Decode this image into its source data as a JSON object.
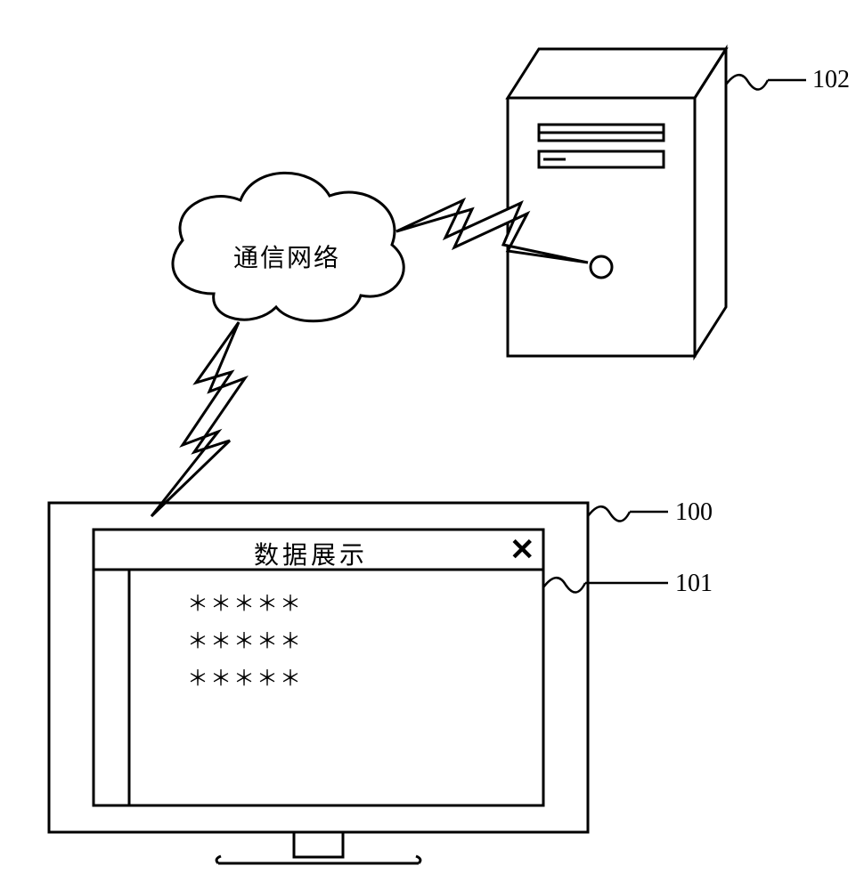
{
  "cloud": {
    "label": "通信网络"
  },
  "labels": {
    "server": "102",
    "monitor": "100",
    "window": "101"
  },
  "client_window": {
    "title": "数据展示",
    "close_symbol": "✕",
    "rows": [
      "＊＊＊＊＊",
      "＊＊＊＊＊",
      "＊＊＊＊＊"
    ]
  }
}
